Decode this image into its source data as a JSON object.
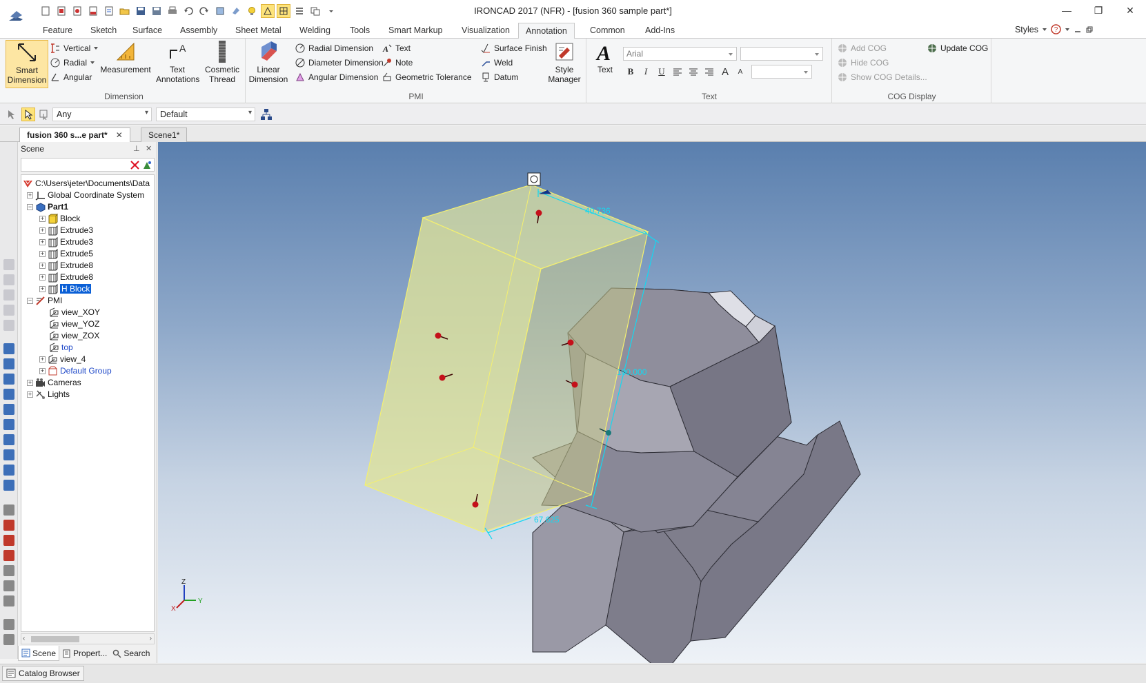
{
  "window": {
    "title": "IRONCAD 2017 (NFR) - [fusion 360 sample part*]",
    "minimize": "—",
    "restore": "❐",
    "close": "✕"
  },
  "ribbon_tabs": [
    "Feature",
    "Sketch",
    "Surface",
    "Assembly",
    "Sheet Metal",
    "Welding",
    "Tools",
    "Smart Markup",
    "Visualization",
    "Annotation",
    "Common",
    "Add-Ins"
  ],
  "active_tab": "Annotation",
  "styles_label": "Styles",
  "ribbon": {
    "dimension": {
      "label": "Dimension",
      "smart_dimension": "Smart Dimension",
      "vertical": "Vertical",
      "radial": "Radial",
      "angular": "Angular",
      "measurement": "Measurement",
      "text_annotations": "Text Annotations",
      "cosmetic_thread": "Cosmetic Thread"
    },
    "pmi": {
      "label": "PMI",
      "linear_dimension": "Linear Dimension",
      "radial_dimension": "Radial Dimension",
      "diameter_dimension": "Diameter Dimension",
      "angular_dimension": "Angular Dimension",
      "text": "Text",
      "note": "Note",
      "geometric_tolerance": "Geometric Tolerance",
      "surface_finish": "Surface Finish",
      "weld": "Weld",
      "datum": "Datum",
      "style_manager": "Style Manager"
    },
    "text": {
      "label": "Text",
      "text_button": "Text",
      "font": "Arial",
      "bold": "B",
      "italic": "I",
      "underline": "U",
      "grow": "A",
      "shrink": "A"
    },
    "cog": {
      "label": "COG Display",
      "add_cog": "Add COG",
      "hide_cog": "Hide COG",
      "show_cog_details": "Show COG Details...",
      "update_cog": "Update COG"
    }
  },
  "selection_bar": {
    "filter": "Any",
    "style": "Default"
  },
  "doc_tabs": [
    {
      "label": "fusion 360 s...e part*",
      "active": true
    },
    {
      "label": "Scene1*",
      "active": false
    }
  ],
  "scene_panel": {
    "title": "Scene",
    "tree": [
      {
        "label": "C:\\Users\\jeter\\Documents\\Data",
        "icon": "scene-root-icon"
      },
      {
        "label": "Global Coordinate System",
        "icon": "coordinate-system-icon"
      },
      {
        "label": "Part1",
        "icon": "part-icon"
      },
      {
        "label": "Block",
        "icon": "block-icon"
      },
      {
        "label": "Extrude3",
        "icon": "extrude-icon"
      },
      {
        "label": "Extrude3",
        "icon": "extrude-icon"
      },
      {
        "label": "Extrude5",
        "icon": "extrude-icon"
      },
      {
        "label": "Extrude8",
        "icon": "extrude-icon"
      },
      {
        "label": "Extrude8",
        "icon": "extrude-icon"
      },
      {
        "label": "H Block",
        "icon": "extrude-icon"
      },
      {
        "label": "PMI",
        "icon": "pmi-icon"
      },
      {
        "label": "view_XOY",
        "icon": "view-icon"
      },
      {
        "label": "view_YOZ",
        "icon": "view-icon"
      },
      {
        "label": "view_ZOX",
        "icon": "view-icon"
      },
      {
        "label": "top",
        "icon": "view-icon"
      },
      {
        "label": "view_4",
        "icon": "view-icon"
      },
      {
        "label": "Default Group",
        "icon": "group-icon"
      },
      {
        "label": "Cameras",
        "icon": "camera-icon"
      },
      {
        "label": "Lights",
        "icon": "light-icon"
      }
    ],
    "tabs": [
      "Scene",
      "Propert...",
      "Search"
    ]
  },
  "viewport": {
    "dimensions": [
      "40.736",
      "100.000",
      "67.625"
    ],
    "triad": {
      "z": "Z",
      "y": "Y",
      "x": "X"
    }
  },
  "statusbar": {
    "catalog_browser": "Catalog Browser"
  },
  "colors": {
    "accent": "#fde37a",
    "selection": "#0a5fd6",
    "dimension": "#14d8f0",
    "shape_box": "#dfe69a",
    "shape_body": "#8e8e9a"
  }
}
